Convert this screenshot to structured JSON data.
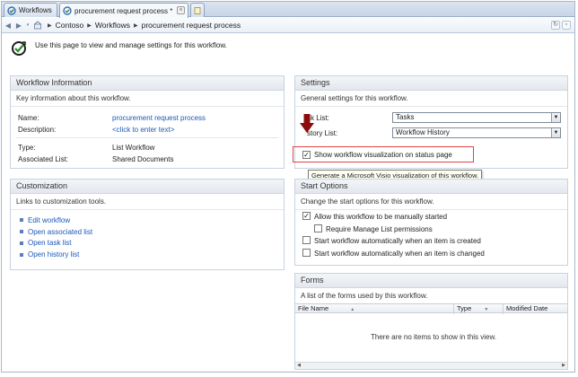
{
  "tabs": [
    {
      "label": "Workflows"
    },
    {
      "label": "procurement request process *"
    }
  ],
  "address": {
    "crumbs": [
      "Contoso",
      "Workflows",
      "procurement request process"
    ]
  },
  "intro": {
    "text": "Use this page to view and manage settings for this workflow."
  },
  "workflow_info": {
    "title": "Workflow Information",
    "description": "Key information about this workflow.",
    "name_label": "Name:",
    "name_value": "procurement request process",
    "description_label": "Description:",
    "description_value": "<click to enter text>",
    "type_label": "Type:",
    "type_value": "List Workflow",
    "associated_label": "Associated List:",
    "associated_value": "Shared Documents"
  },
  "customization": {
    "title": "Customization",
    "description": "Links to customization tools.",
    "links": [
      "Edit workflow",
      "Open associated list",
      "Open task list",
      "Open history list"
    ]
  },
  "settings": {
    "title": "Settings",
    "description": "General settings for this workflow.",
    "task_list_label": "sk List:",
    "task_list_value": "Tasks",
    "history_list_label": "story List:",
    "history_list_value": "Workflow History",
    "show_visualization_label": "Show workflow visualization on status page",
    "show_visualization_checked": true,
    "tooltip": "Generate a Microsoft Visio visualization of this workflow."
  },
  "start_options": {
    "title": "Start Options",
    "description": "Change the start options for this workflow.",
    "options": [
      {
        "label": "Allow this workflow to be manually started",
        "checked": true
      },
      {
        "label": "Require Manage List permissions",
        "checked": false
      },
      {
        "label": "Start workflow automatically when an item is created",
        "checked": false
      },
      {
        "label": "Start workflow automatically when an item is changed",
        "checked": false
      }
    ]
  },
  "forms": {
    "title": "Forms",
    "description": "A list of the forms used by this workflow.",
    "columns": [
      "File Name",
      "Type",
      "Modified Date"
    ],
    "empty_message": "There are no items to show in this view."
  },
  "colors": {
    "link": "#1b58b8",
    "highlight_box": "#e04444",
    "arrow": "#8b0c0c"
  }
}
